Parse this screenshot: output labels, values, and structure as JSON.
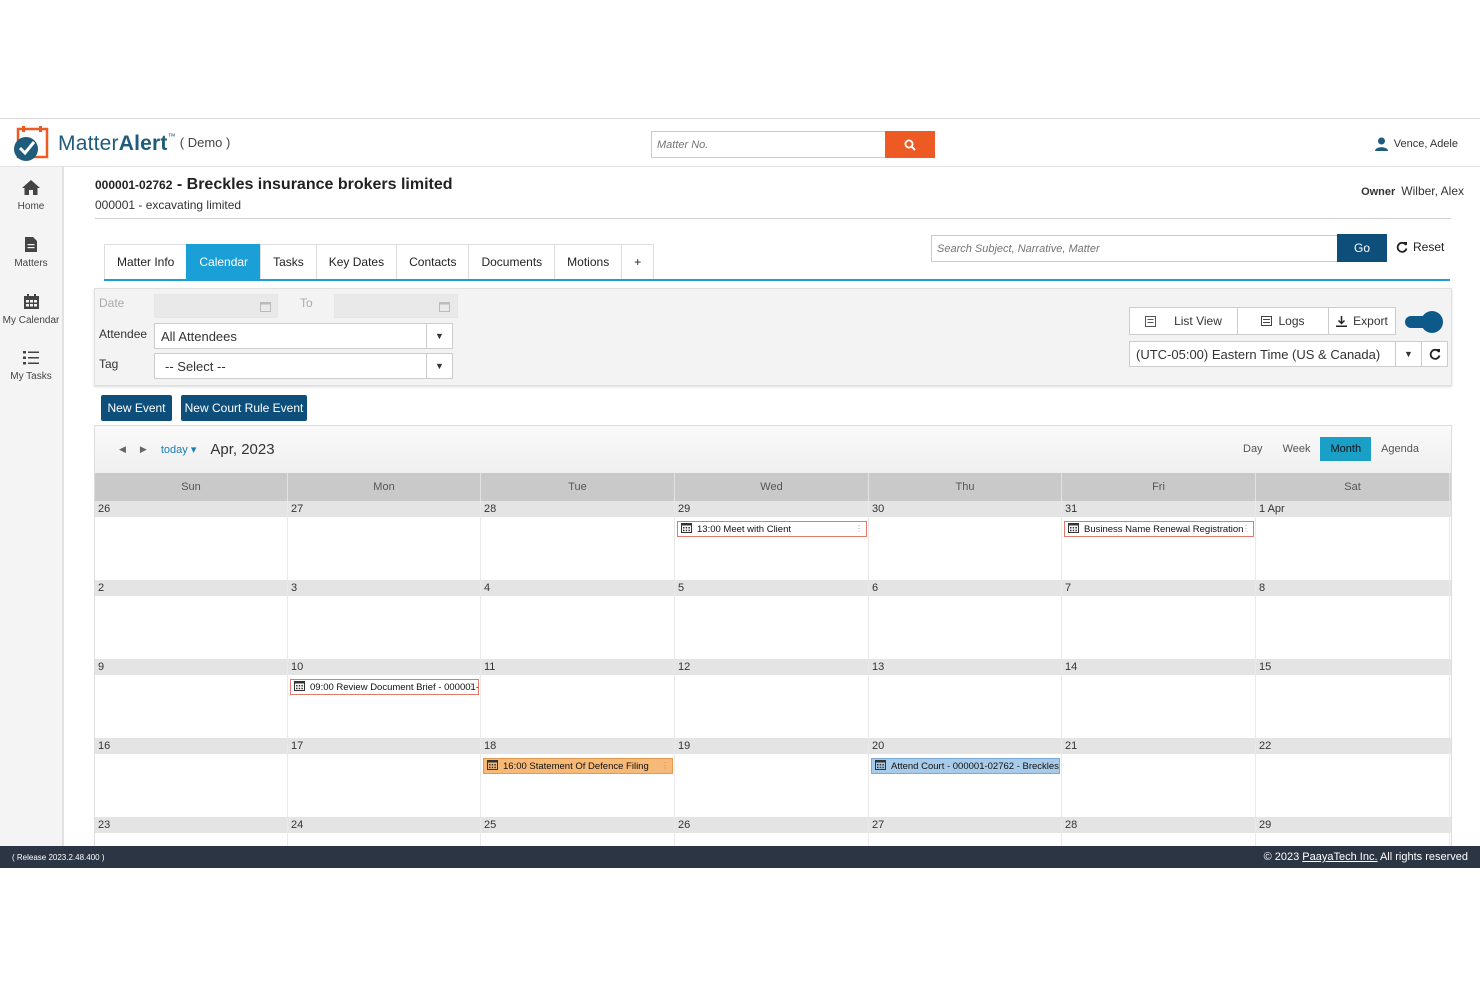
{
  "app": {
    "brand_pre": "Matter",
    "brand_bold": "Alert",
    "brand_tm": "™",
    "demo_label": "( Demo )",
    "colors": {
      "brand_blue": "#1f5b7a",
      "accent_orange": "#ee5a24",
      "tab_blue": "#1a9fd7",
      "navy": "#0d4f7a",
      "footer": "#2b3544"
    }
  },
  "header": {
    "matter_search_placeholder": "Matter No.",
    "user_name": "Vence, Adele"
  },
  "sidebar": {
    "items": [
      {
        "label": "Home",
        "icon": "home-icon"
      },
      {
        "label": "Matters",
        "icon": "document-icon"
      },
      {
        "label": "My Calendar",
        "icon": "calendar-icon"
      },
      {
        "label": "My Tasks",
        "icon": "list-icon"
      }
    ]
  },
  "matter": {
    "number": "000001-02762",
    "separator": " - ",
    "name": "Breckles insurance brokers limited",
    "client": "000001 - excavating limited",
    "owner_label": "Owner",
    "owner_name": "Wilber, Alex"
  },
  "tabs": [
    "Matter Info",
    "Calendar",
    "Tasks",
    "Key Dates",
    "Contacts",
    "Documents",
    "Motions",
    "+"
  ],
  "active_tab": "Calendar",
  "search": {
    "placeholder": "Search Subject, Narrative, Matter",
    "go_label": "Go",
    "reset_label": "Reset"
  },
  "filters": {
    "date_label": "Date",
    "to_label": "To",
    "attendee_label": "Attendee",
    "attendee_value": "All Attendees",
    "tag_label": "Tag",
    "tag_value": "-- Select --",
    "list_view_label": "List View",
    "logs_label": "Logs",
    "export_label": "Export",
    "timezone_value": "(UTC-05:00) Eastern Time (US & Canada)"
  },
  "actions": {
    "new_event": "New Event",
    "new_court_rule_event": "New Court Rule Event"
  },
  "calendar": {
    "today_label": "today",
    "title": "Apr, 2023",
    "views": [
      "Day",
      "Week",
      "Month",
      "Agenda"
    ],
    "active_view": "Month",
    "weekdays": [
      "Sun",
      "Mon",
      "Tue",
      "Wed",
      "Thu",
      "Fri",
      "Sat"
    ],
    "weeks": [
      {
        "days": [
          "26",
          "27",
          "28",
          "29",
          "30",
          "31",
          "1 Apr"
        ],
        "events": [
          {
            "col": 3,
            "text": "13:00 Meet with Client",
            "style": "outline"
          },
          {
            "col": 5,
            "text": "Business Name Renewal Registration",
            "style": "outline"
          }
        ]
      },
      {
        "days": [
          "2",
          "3",
          "4",
          "5",
          "6",
          "7",
          "8"
        ],
        "events": []
      },
      {
        "days": [
          "9",
          "10",
          "11",
          "12",
          "13",
          "14",
          "15"
        ],
        "events": [
          {
            "col": 1,
            "text": "09:00 Review Document Brief - 000001-",
            "style": "outline"
          }
        ]
      },
      {
        "days": [
          "16",
          "17",
          "18",
          "19",
          "20",
          "21",
          "22"
        ],
        "events": [
          {
            "col": 2,
            "text": "16:00 Statement Of Defence Filing",
            "style": "orange"
          },
          {
            "col": 4,
            "text": "Attend Court - 000001-02762 - Breckles",
            "style": "blue"
          }
        ]
      },
      {
        "days": [
          "23",
          "24",
          "25",
          "26",
          "27",
          "28",
          "29"
        ],
        "events": []
      }
    ]
  },
  "footer": {
    "release": "( Release 2023.2.48.400 )",
    "copyright_pre": "© 2023 ",
    "company": "PaayaTech Inc.",
    "copyright_post": " All rights reserved"
  }
}
